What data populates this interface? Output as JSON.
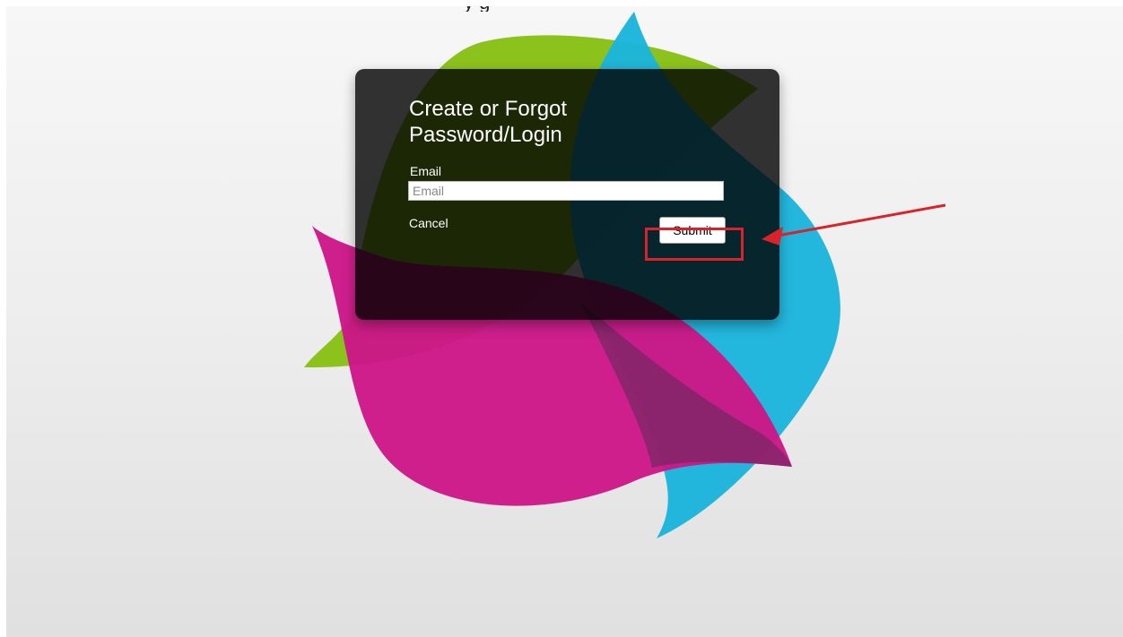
{
  "page": {
    "top_text_fragment": "y        g",
    "background_top": "#f7f7f7",
    "background_bottom": "#e0e0e0"
  },
  "logo": {
    "icon": "leaf-swirl-logo",
    "colors": {
      "green": "#8cc21c",
      "blue": "#1ab4dc",
      "magenta": "#cc1888"
    }
  },
  "login_card": {
    "title": "Create or Forgot Password/Login",
    "email_label": "Email",
    "email_value": "",
    "email_placeholder": "Email",
    "cancel_label": "Cancel",
    "submit_label": "Submit"
  },
  "annotation": {
    "color": "#d9232b",
    "icon": "arrow-icon"
  }
}
